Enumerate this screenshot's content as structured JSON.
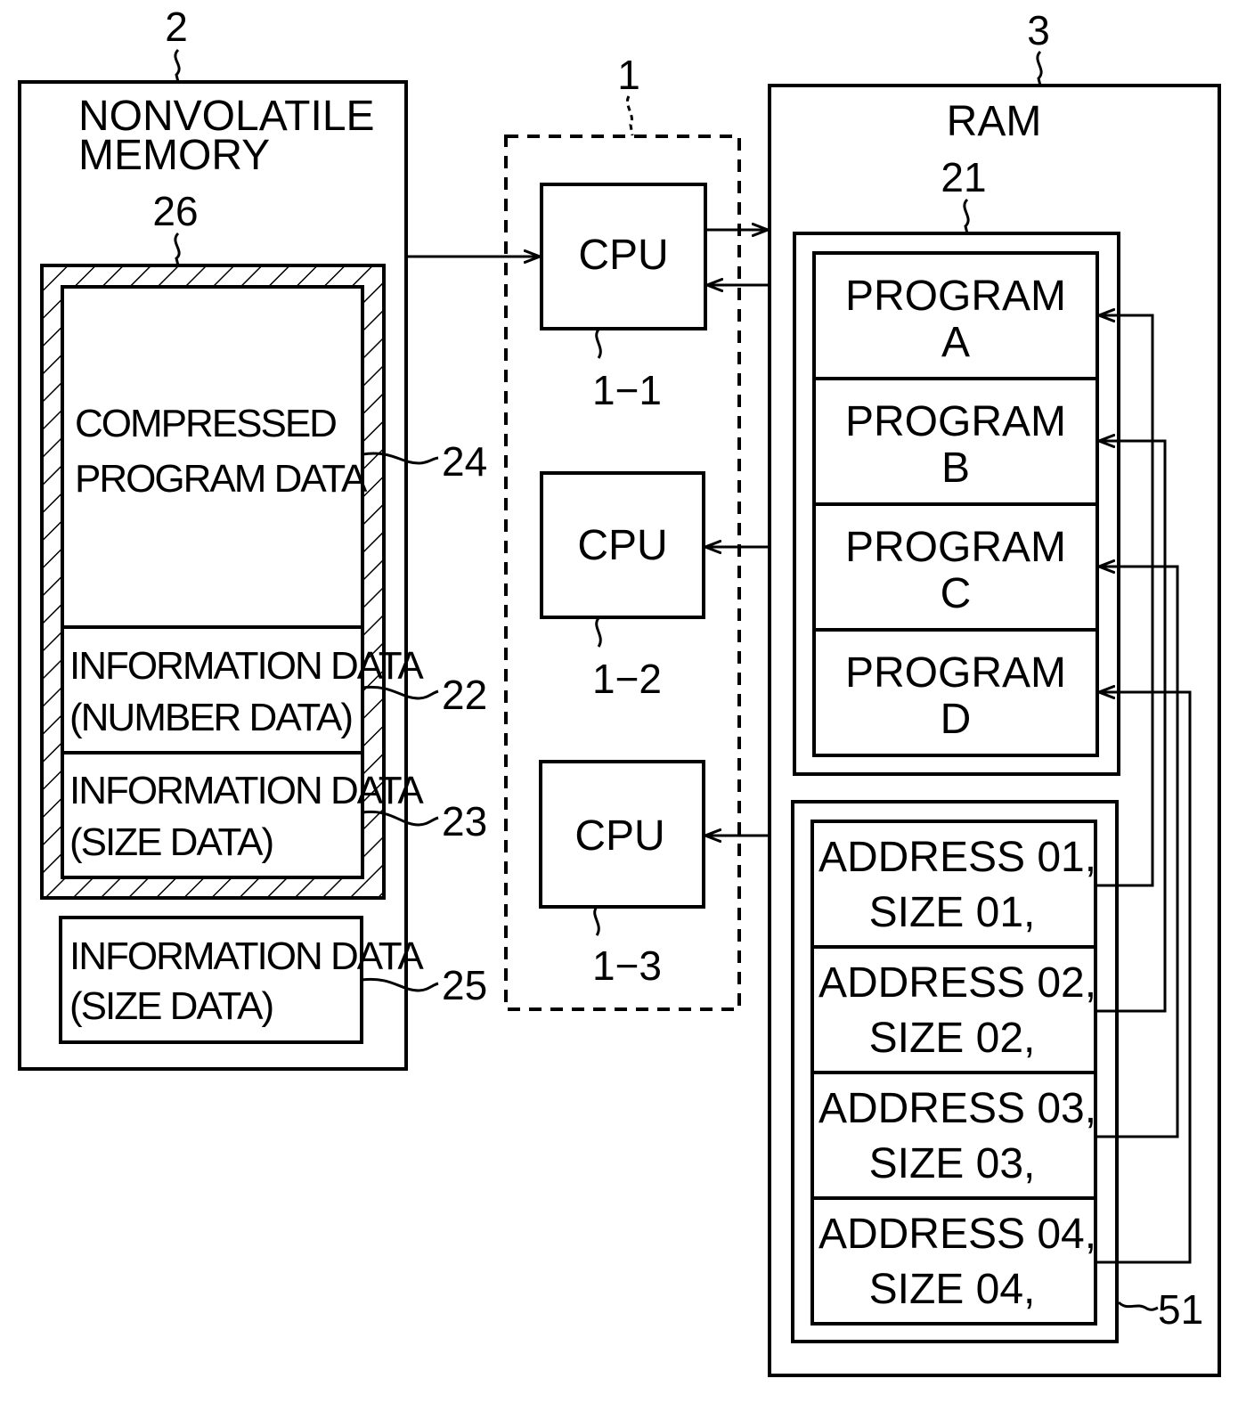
{
  "diagram": {
    "type": "block-diagram",
    "nonvolatile_memory": {
      "ref": "2",
      "title_line1": "NONVOLATILE",
      "title_line2": "MEMORY",
      "region_ref": "26",
      "compressed_data": {
        "line1": "COMPRESSED",
        "line2": "PROGRAM DATA",
        "ref": "24"
      },
      "number_info": {
        "line1": "INFORMATION DATA",
        "line2": "(NUMBER DATA)",
        "ref": "22"
      },
      "size_info_inner": {
        "line1": "INFORMATION DATA",
        "line2": "(SIZE DATA)",
        "ref": "23"
      },
      "size_info_outer": {
        "line1": "INFORMATION DATA",
        "line2": "(SIZE DATA)",
        "ref": "25"
      }
    },
    "processor": {
      "ref": "1",
      "cpus": [
        {
          "label": "CPU",
          "ref": "1−1"
        },
        {
          "label": "CPU",
          "ref": "1−2"
        },
        {
          "label": "CPU",
          "ref": "1−3"
        }
      ]
    },
    "ram": {
      "ref": "3",
      "title": "RAM",
      "programs_ref": "21",
      "programs": [
        {
          "line1": "PROGRAM",
          "line2": "A"
        },
        {
          "line1": "PROGRAM",
          "line2": "B"
        },
        {
          "line1": "PROGRAM",
          "line2": "C"
        },
        {
          "line1": "PROGRAM",
          "line2": "D"
        }
      ],
      "table_ref": "51",
      "entries": [
        {
          "line1": "ADDRESS 01,",
          "line2": "SIZE 01,"
        },
        {
          "line1": "ADDRESS 02,",
          "line2": "SIZE 02,"
        },
        {
          "line1": "ADDRESS 03,",
          "line2": "SIZE 03,"
        },
        {
          "line1": "ADDRESS 04,",
          "line2": "SIZE 04,"
        }
      ]
    }
  }
}
